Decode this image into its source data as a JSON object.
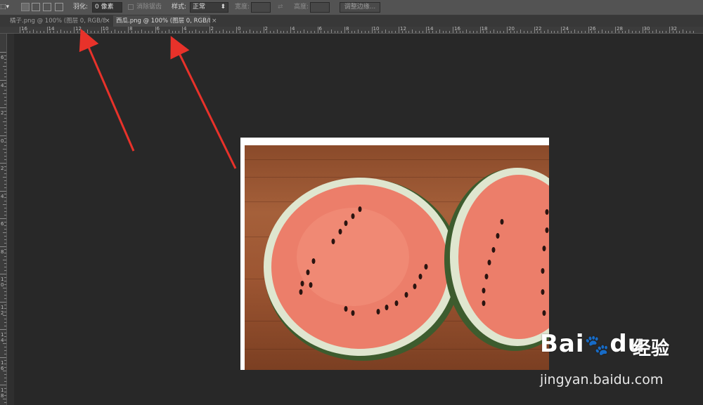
{
  "options_bar": {
    "feather_label": "羽化:",
    "feather_value": "0 像素",
    "antialias_label": "消除锯齿",
    "style_label": "样式:",
    "style_value": "正常",
    "width_label": "宽度:",
    "height_label": "高度:",
    "refine_edge_button": "调整边缘..."
  },
  "tabs": [
    {
      "label": "橘子.png @ 100% (图层 0, RGB/8)",
      "close": "×",
      "active": false
    },
    {
      "label": "西瓜.png @ 100% (图层 0, RGB/8)",
      "close": "×",
      "active": true
    }
  ],
  "ruler_top": {
    "labels": [
      "16",
      "14",
      "12",
      "10",
      "8",
      "6",
      "4",
      "2",
      "0",
      "2",
      "4",
      "6",
      "8",
      "10",
      "12",
      "14",
      "16",
      "18",
      "20",
      "22",
      "24",
      "26",
      "28",
      "30",
      "32"
    ]
  },
  "ruler_left": {
    "labels": [
      "6",
      "4",
      "2",
      "0",
      "2",
      "4",
      "6",
      "8",
      "1 0",
      "1 2",
      "1 4",
      "1 6",
      "1 8"
    ]
  },
  "watermark": {
    "logo_text": "Bai",
    "logo_suffix": "du",
    "cn_text": "经验",
    "url": "jingyan.baidu.com"
  },
  "colors": {
    "arrow": "#e8322a",
    "workspace": "#282828",
    "options_bar": "#535353"
  }
}
